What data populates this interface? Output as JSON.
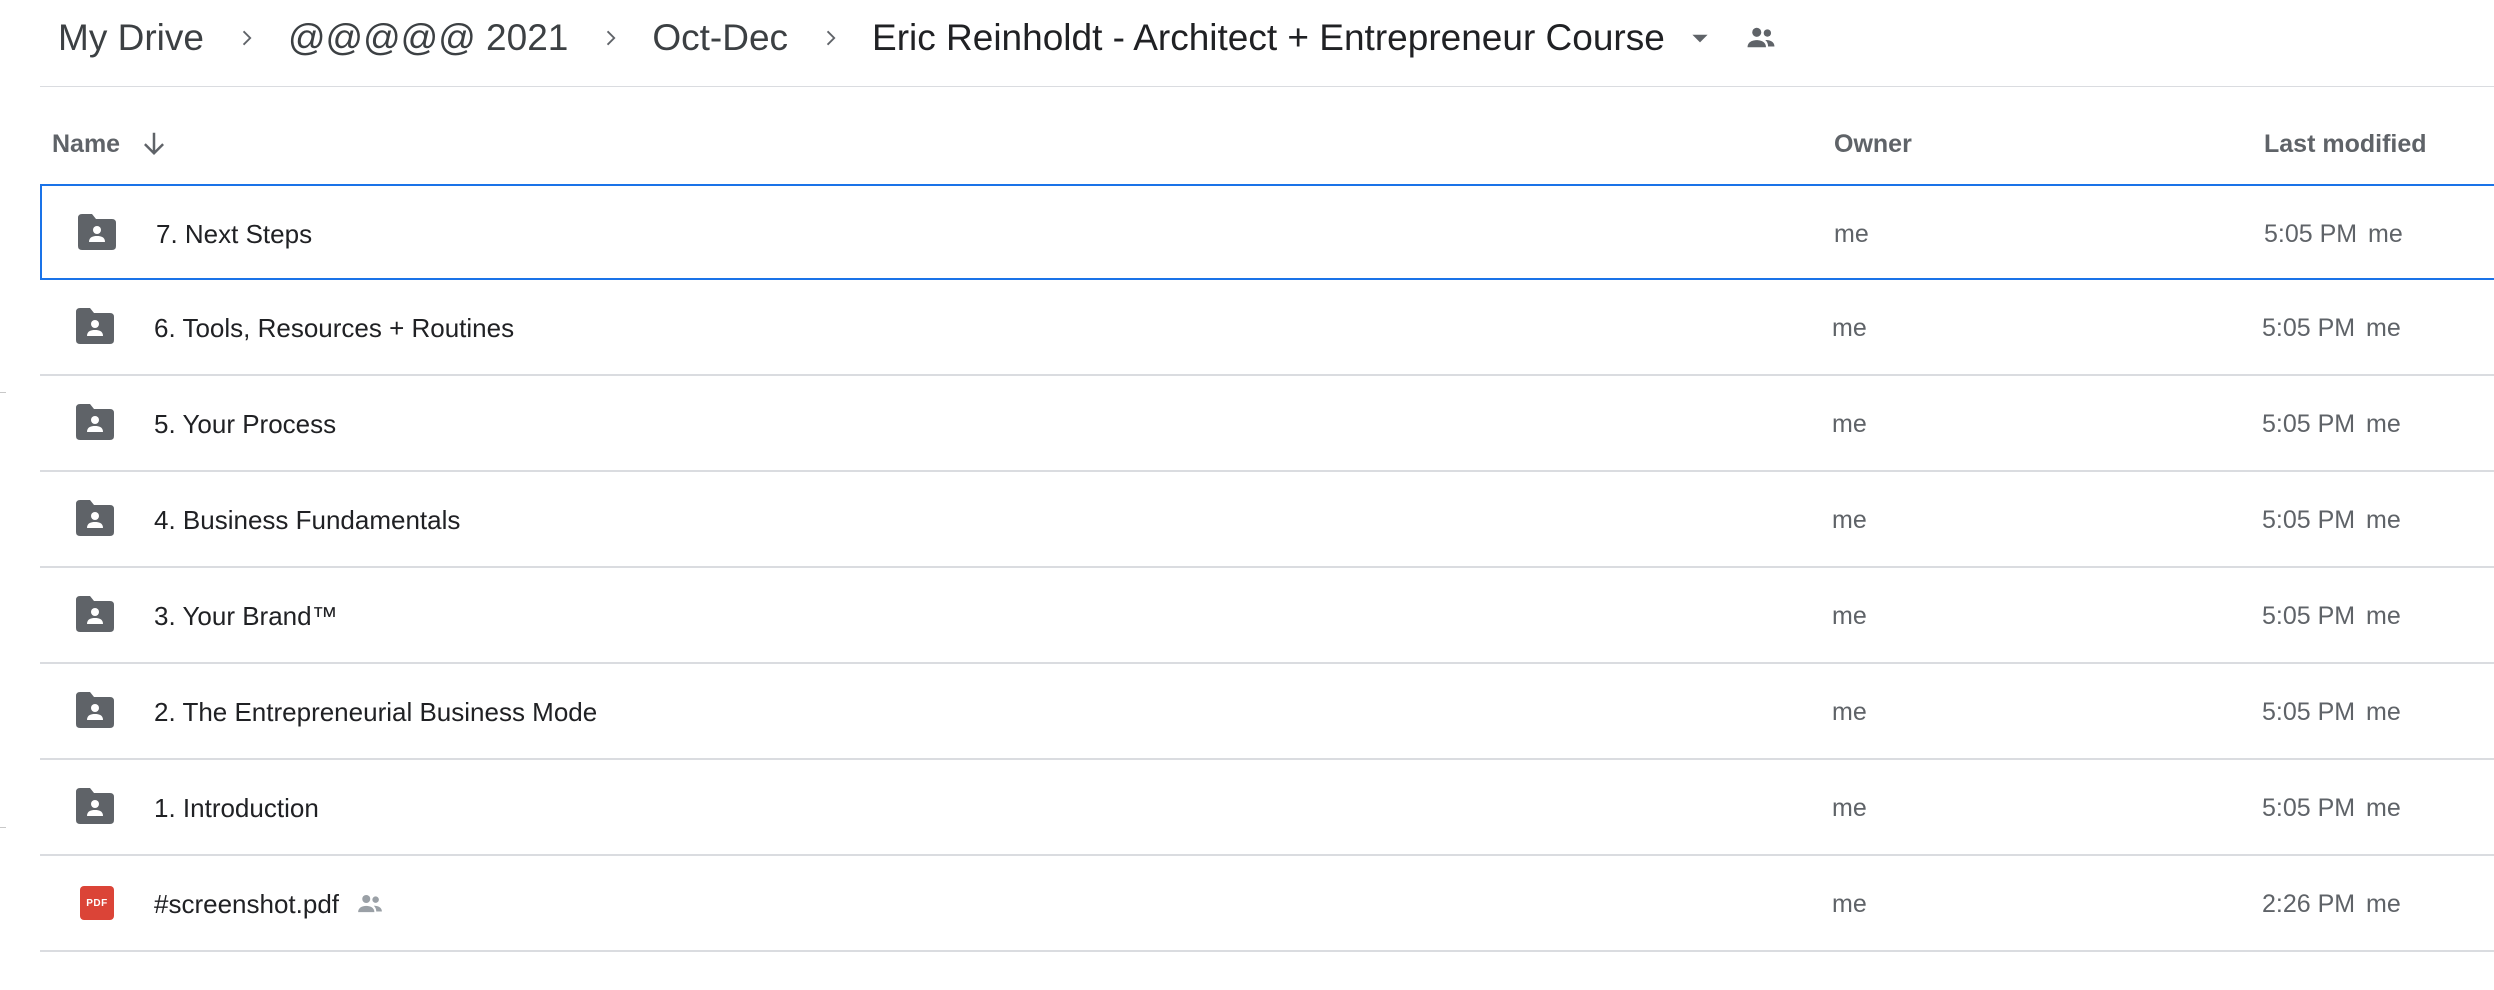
{
  "breadcrumb": {
    "items": [
      "My Drive",
      "@@@@@ 2021",
      "Oct-Dec"
    ],
    "current": "Eric Reinholdt - Architect + Entrepreneur Course"
  },
  "icons": {
    "separator": "chevron-right-icon",
    "dropdown": "caret-down-icon",
    "shared": "people-icon",
    "sort": "arrow-down-icon",
    "folder": "shared-folder-icon",
    "pdf": "pdf-file-icon"
  },
  "colors": {
    "selection_border": "#1a73e8",
    "folder_icon": "#5f6368",
    "pdf_icon": "#db4437"
  },
  "header": {
    "name": "Name",
    "owner": "Owner",
    "last_modified": "Last modified"
  },
  "rows": [
    {
      "name": "7. Next Steps",
      "owner": "me",
      "modified": "5:05 PM",
      "modified_by": "me",
      "type": "folder",
      "selected": true
    },
    {
      "name": "6. Tools, Resources + Routines",
      "owner": "me",
      "modified": "5:05 PM",
      "modified_by": "me",
      "type": "folder"
    },
    {
      "name": "5. Your Process",
      "owner": "me",
      "modified": "5:05 PM",
      "modified_by": "me",
      "type": "folder"
    },
    {
      "name": "4. Business Fundamentals",
      "owner": "me",
      "modified": "5:05 PM",
      "modified_by": "me",
      "type": "folder"
    },
    {
      "name": "3. Your Brand™",
      "owner": "me",
      "modified": "5:05 PM",
      "modified_by": "me",
      "type": "folder"
    },
    {
      "name": "2. The Entrepreneurial Business Mode",
      "owner": "me",
      "modified": "5:05 PM",
      "modified_by": "me",
      "type": "folder"
    },
    {
      "name": "1. Introduction",
      "owner": "me",
      "modified": "5:05 PM",
      "modified_by": "me",
      "type": "folder"
    },
    {
      "name": "#screenshot.pdf",
      "owner": "me",
      "modified": "2:26 PM",
      "modified_by": "me",
      "type": "pdf",
      "shared": true,
      "badge": "PDF"
    }
  ]
}
